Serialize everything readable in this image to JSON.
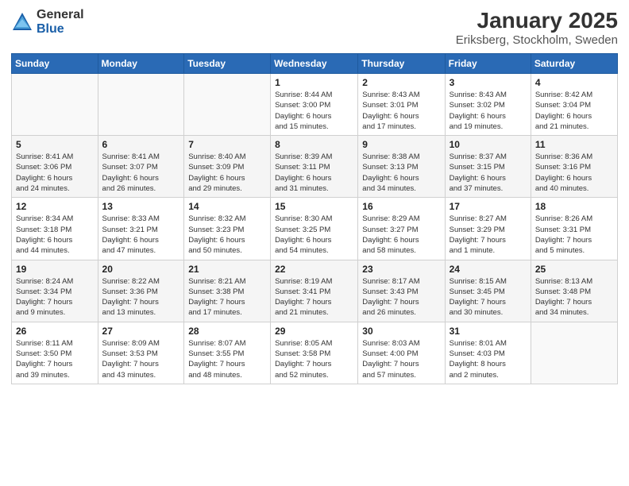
{
  "logo": {
    "general": "General",
    "blue": "Blue"
  },
  "header": {
    "month": "January 2025",
    "location": "Eriksberg, Stockholm, Sweden"
  },
  "days_of_week": [
    "Sunday",
    "Monday",
    "Tuesday",
    "Wednesday",
    "Thursday",
    "Friday",
    "Saturday"
  ],
  "weeks": [
    [
      {
        "day": "",
        "info": ""
      },
      {
        "day": "",
        "info": ""
      },
      {
        "day": "",
        "info": ""
      },
      {
        "day": "1",
        "info": "Sunrise: 8:44 AM\nSunset: 3:00 PM\nDaylight: 6 hours\nand 15 minutes."
      },
      {
        "day": "2",
        "info": "Sunrise: 8:43 AM\nSunset: 3:01 PM\nDaylight: 6 hours\nand 17 minutes."
      },
      {
        "day": "3",
        "info": "Sunrise: 8:43 AM\nSunset: 3:02 PM\nDaylight: 6 hours\nand 19 minutes."
      },
      {
        "day": "4",
        "info": "Sunrise: 8:42 AM\nSunset: 3:04 PM\nDaylight: 6 hours\nand 21 minutes."
      }
    ],
    [
      {
        "day": "5",
        "info": "Sunrise: 8:41 AM\nSunset: 3:06 PM\nDaylight: 6 hours\nand 24 minutes."
      },
      {
        "day": "6",
        "info": "Sunrise: 8:41 AM\nSunset: 3:07 PM\nDaylight: 6 hours\nand 26 minutes."
      },
      {
        "day": "7",
        "info": "Sunrise: 8:40 AM\nSunset: 3:09 PM\nDaylight: 6 hours\nand 29 minutes."
      },
      {
        "day": "8",
        "info": "Sunrise: 8:39 AM\nSunset: 3:11 PM\nDaylight: 6 hours\nand 31 minutes."
      },
      {
        "day": "9",
        "info": "Sunrise: 8:38 AM\nSunset: 3:13 PM\nDaylight: 6 hours\nand 34 minutes."
      },
      {
        "day": "10",
        "info": "Sunrise: 8:37 AM\nSunset: 3:15 PM\nDaylight: 6 hours\nand 37 minutes."
      },
      {
        "day": "11",
        "info": "Sunrise: 8:36 AM\nSunset: 3:16 PM\nDaylight: 6 hours\nand 40 minutes."
      }
    ],
    [
      {
        "day": "12",
        "info": "Sunrise: 8:34 AM\nSunset: 3:18 PM\nDaylight: 6 hours\nand 44 minutes."
      },
      {
        "day": "13",
        "info": "Sunrise: 8:33 AM\nSunset: 3:21 PM\nDaylight: 6 hours\nand 47 minutes."
      },
      {
        "day": "14",
        "info": "Sunrise: 8:32 AM\nSunset: 3:23 PM\nDaylight: 6 hours\nand 50 minutes."
      },
      {
        "day": "15",
        "info": "Sunrise: 8:30 AM\nSunset: 3:25 PM\nDaylight: 6 hours\nand 54 minutes."
      },
      {
        "day": "16",
        "info": "Sunrise: 8:29 AM\nSunset: 3:27 PM\nDaylight: 6 hours\nand 58 minutes."
      },
      {
        "day": "17",
        "info": "Sunrise: 8:27 AM\nSunset: 3:29 PM\nDaylight: 7 hours\nand 1 minute."
      },
      {
        "day": "18",
        "info": "Sunrise: 8:26 AM\nSunset: 3:31 PM\nDaylight: 7 hours\nand 5 minutes."
      }
    ],
    [
      {
        "day": "19",
        "info": "Sunrise: 8:24 AM\nSunset: 3:34 PM\nDaylight: 7 hours\nand 9 minutes."
      },
      {
        "day": "20",
        "info": "Sunrise: 8:22 AM\nSunset: 3:36 PM\nDaylight: 7 hours\nand 13 minutes."
      },
      {
        "day": "21",
        "info": "Sunrise: 8:21 AM\nSunset: 3:38 PM\nDaylight: 7 hours\nand 17 minutes."
      },
      {
        "day": "22",
        "info": "Sunrise: 8:19 AM\nSunset: 3:41 PM\nDaylight: 7 hours\nand 21 minutes."
      },
      {
        "day": "23",
        "info": "Sunrise: 8:17 AM\nSunset: 3:43 PM\nDaylight: 7 hours\nand 26 minutes."
      },
      {
        "day": "24",
        "info": "Sunrise: 8:15 AM\nSunset: 3:45 PM\nDaylight: 7 hours\nand 30 minutes."
      },
      {
        "day": "25",
        "info": "Sunrise: 8:13 AM\nSunset: 3:48 PM\nDaylight: 7 hours\nand 34 minutes."
      }
    ],
    [
      {
        "day": "26",
        "info": "Sunrise: 8:11 AM\nSunset: 3:50 PM\nDaylight: 7 hours\nand 39 minutes."
      },
      {
        "day": "27",
        "info": "Sunrise: 8:09 AM\nSunset: 3:53 PM\nDaylight: 7 hours\nand 43 minutes."
      },
      {
        "day": "28",
        "info": "Sunrise: 8:07 AM\nSunset: 3:55 PM\nDaylight: 7 hours\nand 48 minutes."
      },
      {
        "day": "29",
        "info": "Sunrise: 8:05 AM\nSunset: 3:58 PM\nDaylight: 7 hours\nand 52 minutes."
      },
      {
        "day": "30",
        "info": "Sunrise: 8:03 AM\nSunset: 4:00 PM\nDaylight: 7 hours\nand 57 minutes."
      },
      {
        "day": "31",
        "info": "Sunrise: 8:01 AM\nSunset: 4:03 PM\nDaylight: 8 hours\nand 2 minutes."
      },
      {
        "day": "",
        "info": ""
      }
    ]
  ]
}
